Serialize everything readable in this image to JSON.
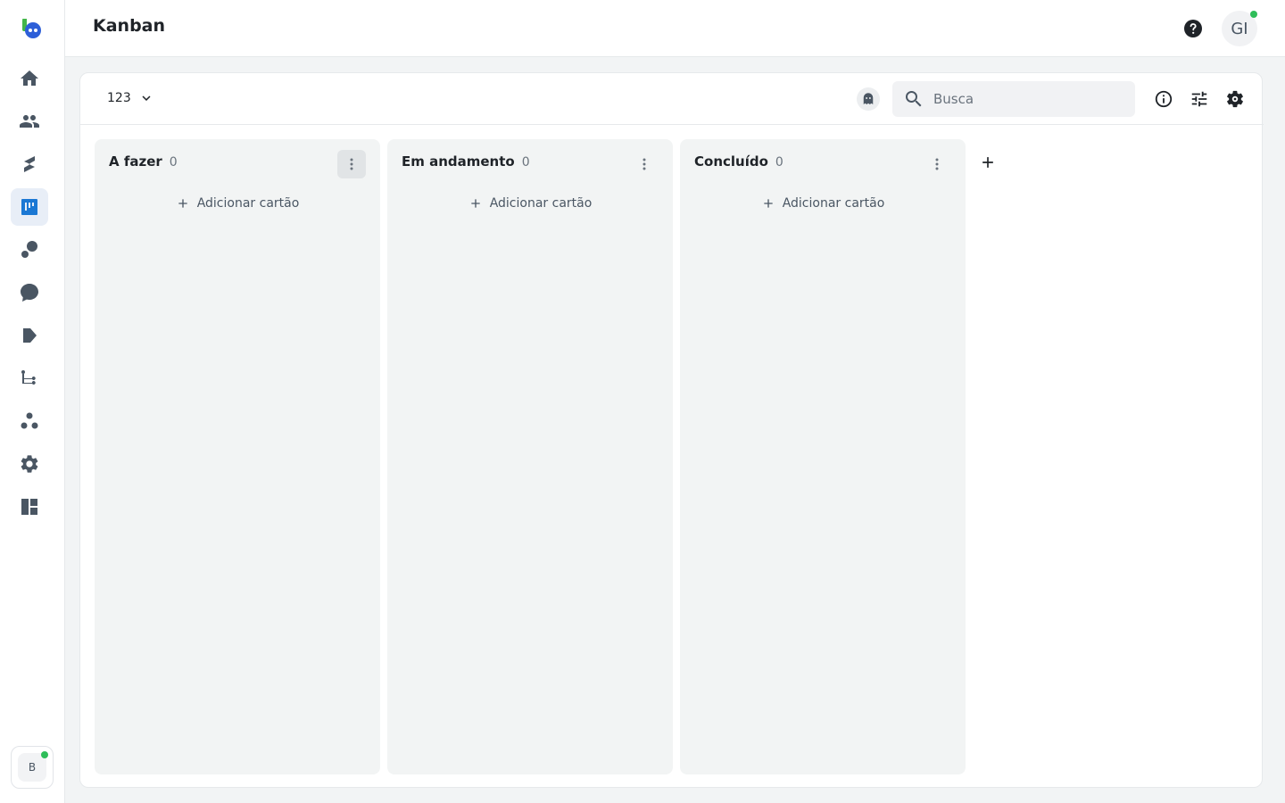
{
  "header": {
    "title": "Kanban",
    "user_initials": "GI"
  },
  "sidebar": {
    "items": [
      {
        "name": "home-icon"
      },
      {
        "name": "contacts-icon"
      },
      {
        "name": "campaigns-icon"
      },
      {
        "name": "kanban-icon",
        "active": true
      },
      {
        "name": "tags-icon"
      },
      {
        "name": "chat-icon"
      },
      {
        "name": "tickets-icon"
      },
      {
        "name": "flows-icon"
      },
      {
        "name": "integrations-icon"
      },
      {
        "name": "settings-icon"
      },
      {
        "name": "dashboard-icon"
      }
    ],
    "workspace_initial": "B"
  },
  "toolbar": {
    "board_name": "123",
    "search_placeholder": "Busca"
  },
  "columns": [
    {
      "title": "A fazer",
      "count": "0",
      "add_label": "Adicionar cartão"
    },
    {
      "title": "Em andamento",
      "count": "0",
      "add_label": "Adicionar cartão"
    },
    {
      "title": "Concluído",
      "count": "0",
      "add_label": "Adicionar cartão"
    }
  ],
  "colors": {
    "accent": "#1b78d4",
    "online": "#2ebd59",
    "column_bg": "#f2f4f4"
  }
}
